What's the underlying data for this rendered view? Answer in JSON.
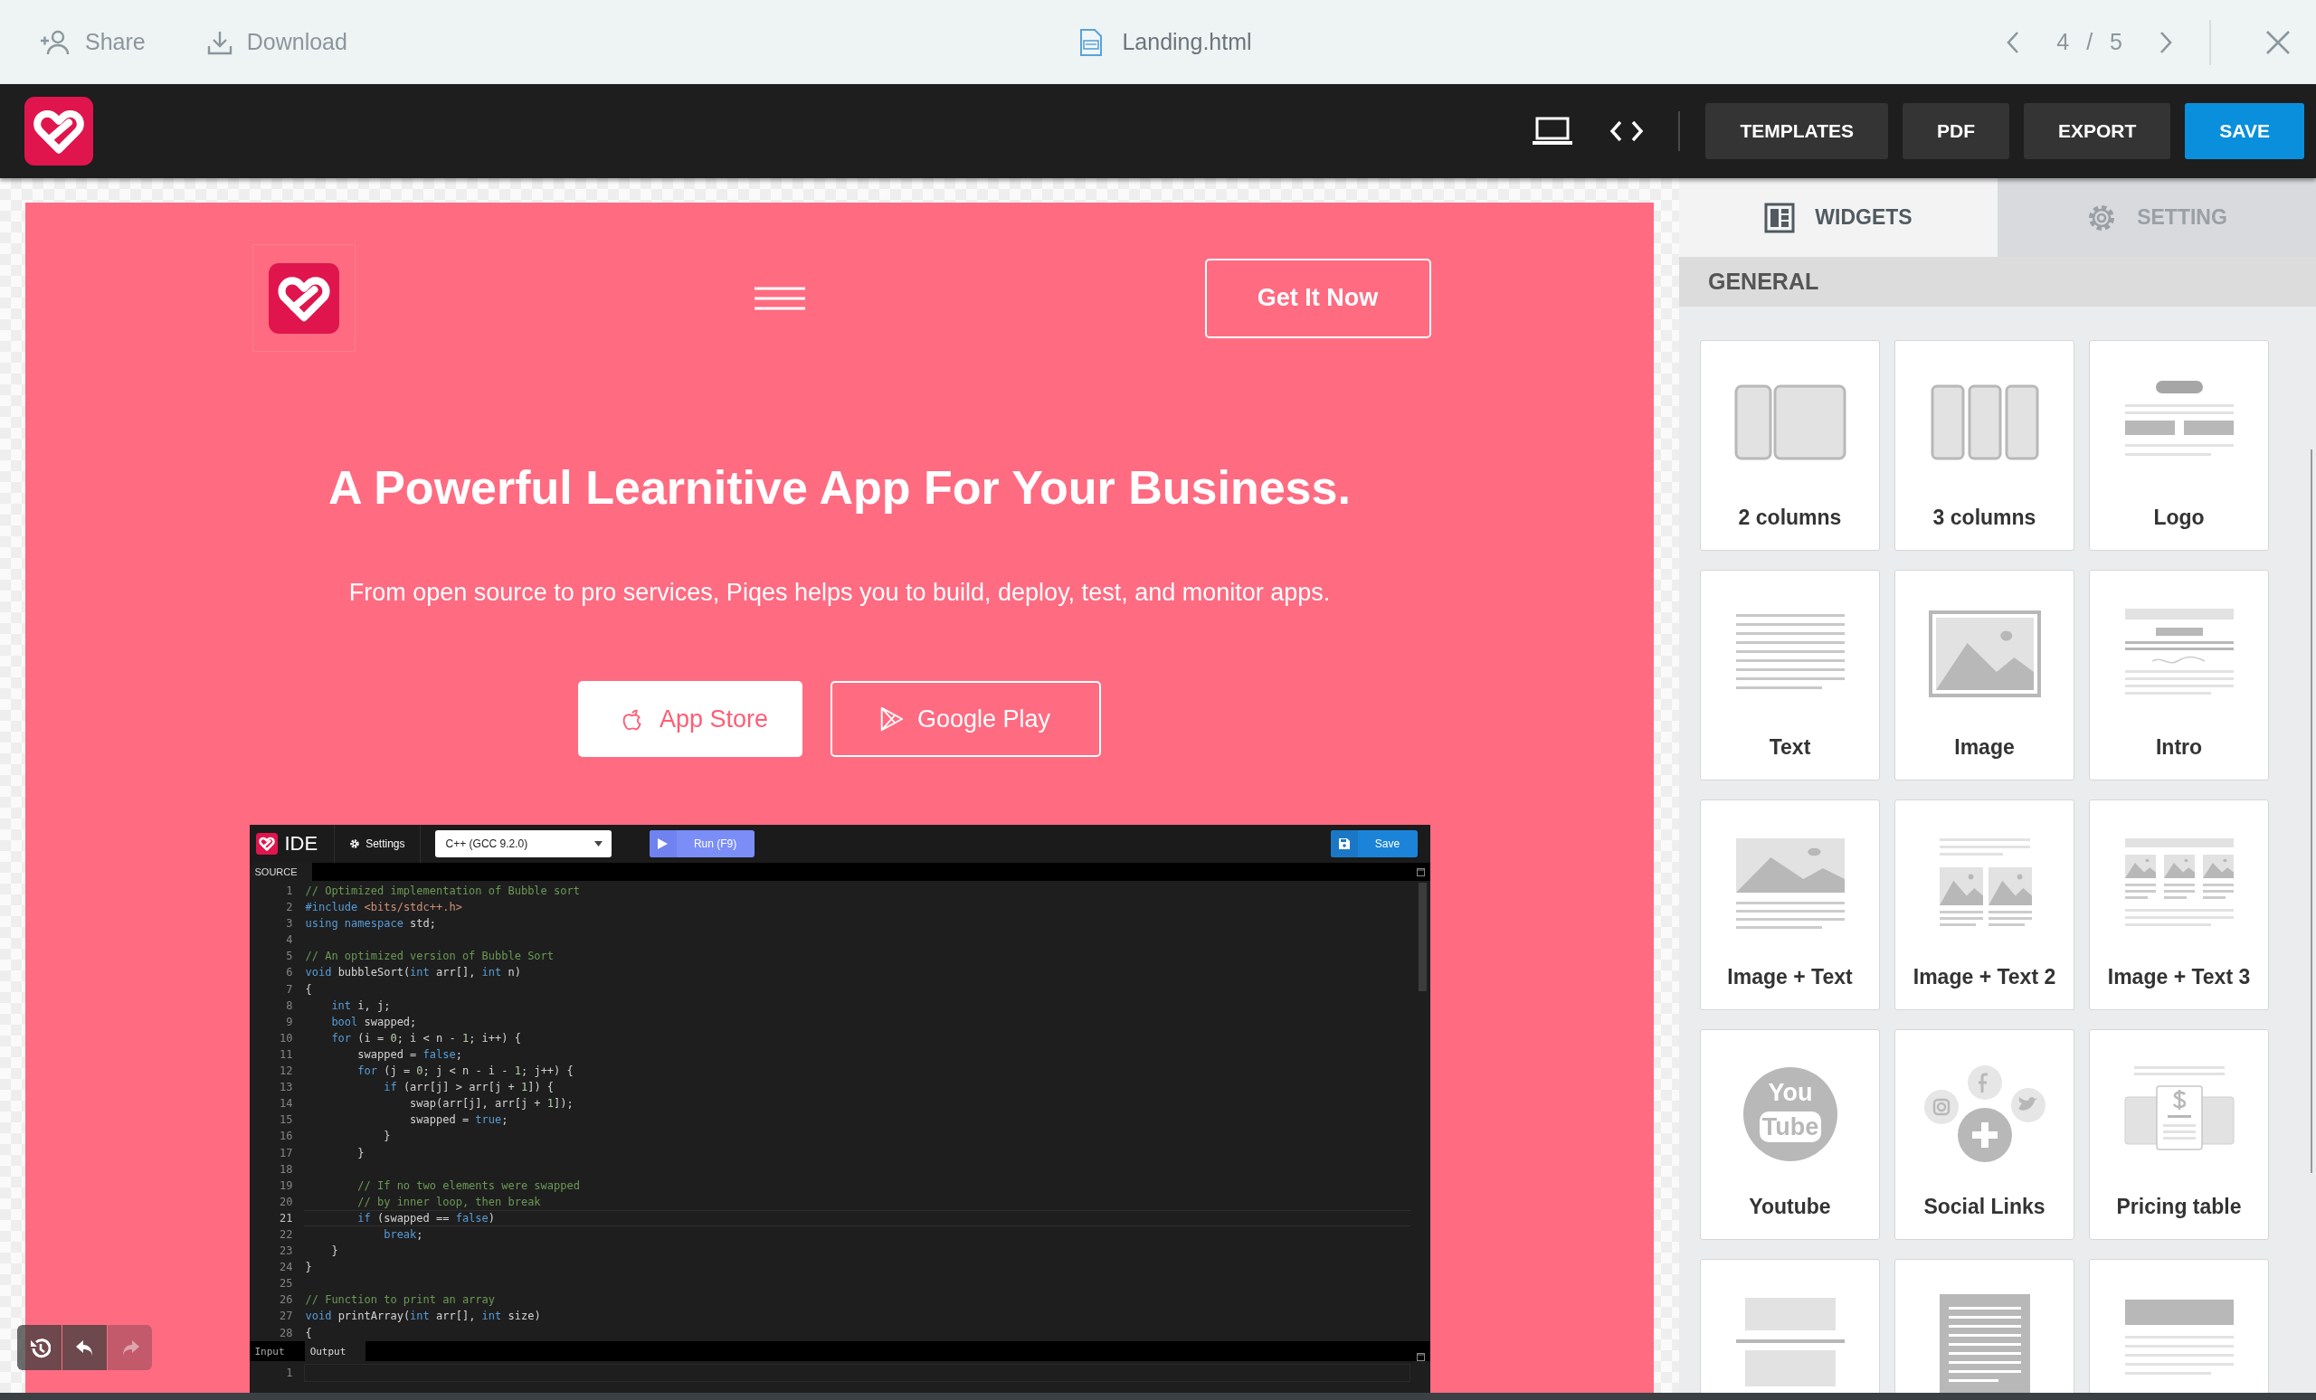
{
  "topbar": {
    "share": "Share",
    "download": "Download",
    "file": "Landing.html",
    "pager": "4 / 5"
  },
  "toolbar": {
    "buttons": [
      {
        "label": "TEMPLATES",
        "kind": "dark"
      },
      {
        "label": "PDF",
        "kind": "dark"
      },
      {
        "label": "EXPORT",
        "kind": "dark"
      },
      {
        "label": "SAVE",
        "kind": "primary"
      }
    ]
  },
  "page": {
    "cta": "Get It Now",
    "heading": "A Powerful Learnitive App For Your Business.",
    "subtitle": "From open source to pro services, Piqes helps you to build, deploy, test, and monitor apps.",
    "store_buttons": [
      {
        "label": "App Store",
        "kind": "filled"
      },
      {
        "label": "Google Play",
        "kind": "outline"
      }
    ]
  },
  "ide": {
    "title": "IDE",
    "settings": "Settings",
    "language": "C++ (GCC 9.2.0)",
    "run": "Run (F9)",
    "save": "Save",
    "source_tab": "SOURCE",
    "lines": [
      {
        "number": "1",
        "current": false,
        "tokens": [
          {
            "kind": "comment",
            "text": "// Optimized implementation of Bubble sort"
          }
        ]
      },
      {
        "number": "2",
        "current": false,
        "tokens": [
          {
            "kind": "keyword",
            "text": "#include "
          },
          {
            "kind": "string",
            "text": "<bits/stdc++.h>"
          }
        ]
      },
      {
        "number": "3",
        "current": false,
        "tokens": [
          {
            "kind": "keyword",
            "text": "using namespace"
          },
          {
            "kind": "plain",
            "text": " std;"
          }
        ]
      },
      {
        "number": "4",
        "current": false
      },
      {
        "number": "5",
        "current": false,
        "tokens": [
          {
            "kind": "comment",
            "text": "// An optimized version of Bubble Sort"
          }
        ]
      },
      {
        "number": "6",
        "current": false,
        "tokens": [
          {
            "kind": "keyword",
            "text": "void"
          },
          {
            "kind": "plain",
            "text": " bubbleSort("
          },
          {
            "kind": "keyword",
            "text": "int"
          },
          {
            "kind": "plain",
            "text": " arr[], "
          },
          {
            "kind": "keyword",
            "text": "int"
          },
          {
            "kind": "plain",
            "text": " n)"
          }
        ]
      },
      {
        "number": "7",
        "current": false,
        "tokens": [
          {
            "kind": "plain",
            "text": "{"
          }
        ]
      },
      {
        "number": "8",
        "current": false,
        "tokens": [
          {
            "kind": "keyword",
            "text": "    int"
          },
          {
            "kind": "plain",
            "text": " i, j;"
          }
        ]
      },
      {
        "number": "9",
        "current": false,
        "tokens": [
          {
            "kind": "keyword",
            "text": "    bool"
          },
          {
            "kind": "plain",
            "text": " swapped;"
          }
        ]
      },
      {
        "number": "10",
        "current": false,
        "tokens": [
          {
            "kind": "keyword",
            "text": "    for"
          },
          {
            "kind": "plain",
            "text": " (i = "
          },
          {
            "kind": "number",
            "text": "0"
          },
          {
            "kind": "plain",
            "text": "; i < n - "
          },
          {
            "kind": "number",
            "text": "1"
          },
          {
            "kind": "plain",
            "text": "; i++) {"
          }
        ]
      },
      {
        "number": "11",
        "current": false,
        "tokens": [
          {
            "kind": "plain",
            "text": "        swapped = "
          },
          {
            "kind": "keyword",
            "text": "false"
          },
          {
            "kind": "plain",
            "text": ";"
          }
        ]
      },
      {
        "number": "12",
        "current": false,
        "tokens": [
          {
            "kind": "keyword",
            "text": "        for"
          },
          {
            "kind": "plain",
            "text": " (j = "
          },
          {
            "kind": "number",
            "text": "0"
          },
          {
            "kind": "plain",
            "text": "; j < n - i - "
          },
          {
            "kind": "number",
            "text": "1"
          },
          {
            "kind": "plain",
            "text": "; j++) {"
          }
        ]
      },
      {
        "number": "13",
        "current": false,
        "tokens": [
          {
            "kind": "keyword",
            "text": "            if"
          },
          {
            "kind": "plain",
            "text": " (arr[j] > arr[j + "
          },
          {
            "kind": "number",
            "text": "1"
          },
          {
            "kind": "plain",
            "text": "]) {"
          }
        ]
      },
      {
        "number": "14",
        "current": false,
        "tokens": [
          {
            "kind": "plain",
            "text": "                swap(arr[j], arr[j + "
          },
          {
            "kind": "number",
            "text": "1"
          },
          {
            "kind": "plain",
            "text": "]);"
          }
        ]
      },
      {
        "number": "15",
        "current": false,
        "tokens": [
          {
            "kind": "plain",
            "text": "                swapped = "
          },
          {
            "kind": "keyword",
            "text": "true"
          },
          {
            "kind": "plain",
            "text": ";"
          }
        ]
      },
      {
        "number": "16",
        "current": false,
        "tokens": [
          {
            "kind": "plain",
            "text": "            }"
          }
        ]
      },
      {
        "number": "17",
        "current": false,
        "tokens": [
          {
            "kind": "plain",
            "text": "        }"
          }
        ]
      },
      {
        "number": "18",
        "current": false
      },
      {
        "number": "19",
        "current": false,
        "tokens": [
          {
            "kind": "comment",
            "text": "        // If no two elements were swapped"
          }
        ]
      },
      {
        "number": "20",
        "current": false,
        "tokens": [
          {
            "kind": "comment",
            "text": "        // by inner loop, then break"
          }
        ]
      },
      {
        "number": "21",
        "current": true,
        "tokens": [
          {
            "kind": "keyword",
            "text": "        if"
          },
          {
            "kind": "plain",
            "text": " (swapped == "
          },
          {
            "kind": "keyword",
            "text": "false"
          },
          {
            "kind": "plain",
            "text": ")"
          }
        ]
      },
      {
        "number": "22",
        "current": false,
        "tokens": [
          {
            "kind": "keyword",
            "text": "            break"
          },
          {
            "kind": "plain",
            "text": ";"
          }
        ]
      },
      {
        "number": "23",
        "current": false,
        "tokens": [
          {
            "kind": "plain",
            "text": "    }"
          }
        ]
      },
      {
        "number": "24",
        "current": false,
        "tokens": [
          {
            "kind": "plain",
            "text": "}"
          }
        ]
      },
      {
        "number": "25",
        "current": false
      },
      {
        "number": "26",
        "current": false,
        "tokens": [
          {
            "kind": "comment",
            "text": "// Function to print an array"
          }
        ]
      },
      {
        "number": "27",
        "current": false,
        "tokens": [
          {
            "kind": "keyword",
            "text": "void"
          },
          {
            "kind": "plain",
            "text": " printArray("
          },
          {
            "kind": "keyword",
            "text": "int"
          },
          {
            "kind": "plain",
            "text": " arr[], "
          },
          {
            "kind": "keyword",
            "text": "int"
          },
          {
            "kind": "plain",
            "text": " size)"
          }
        ]
      },
      {
        "number": "28",
        "current": false,
        "tokens": [
          {
            "kind": "plain",
            "text": "{"
          }
        ]
      }
    ],
    "io_tabs": [
      {
        "label": "Input",
        "selected": false
      },
      {
        "label": "Output",
        "selected": true
      }
    ],
    "output_lines": [
      "1"
    ]
  },
  "history": [
    {
      "kind": "history",
      "disabled": false
    },
    {
      "kind": "undo",
      "disabled": false
    },
    {
      "kind": "redo",
      "disabled": true
    }
  ],
  "panel": {
    "tabs": [
      {
        "label": "WIDGETS",
        "kind": "widgets",
        "selected": true
      },
      {
        "label": "SETTING",
        "kind": "setting",
        "selected": false
      }
    ],
    "section": "GENERAL",
    "widgets": [
      {
        "kind": "columns2",
        "label": "2 columns"
      },
      {
        "kind": "columns3",
        "label": "3 columns"
      },
      {
        "kind": "logo",
        "label": "Logo"
      },
      {
        "kind": "text",
        "label": "Text"
      },
      {
        "kind": "image",
        "label": "Image"
      },
      {
        "kind": "intro",
        "label": "Intro"
      },
      {
        "kind": "imagetext",
        "label": "Image + Text"
      },
      {
        "kind": "imagetext2",
        "label": "Image + Text 2"
      },
      {
        "kind": "imagetext3",
        "label": "Image + Text 3"
      },
      {
        "kind": "youtube",
        "label": "Youtube",
        "icon_text": [
          "You",
          "Tube"
        ]
      },
      {
        "kind": "social",
        "label": "Social Links"
      },
      {
        "kind": "pricing",
        "label": "Pricing table"
      },
      {
        "kind": "divider"
      },
      {
        "kind": "textblock"
      },
      {
        "kind": "banner"
      }
    ]
  }
}
